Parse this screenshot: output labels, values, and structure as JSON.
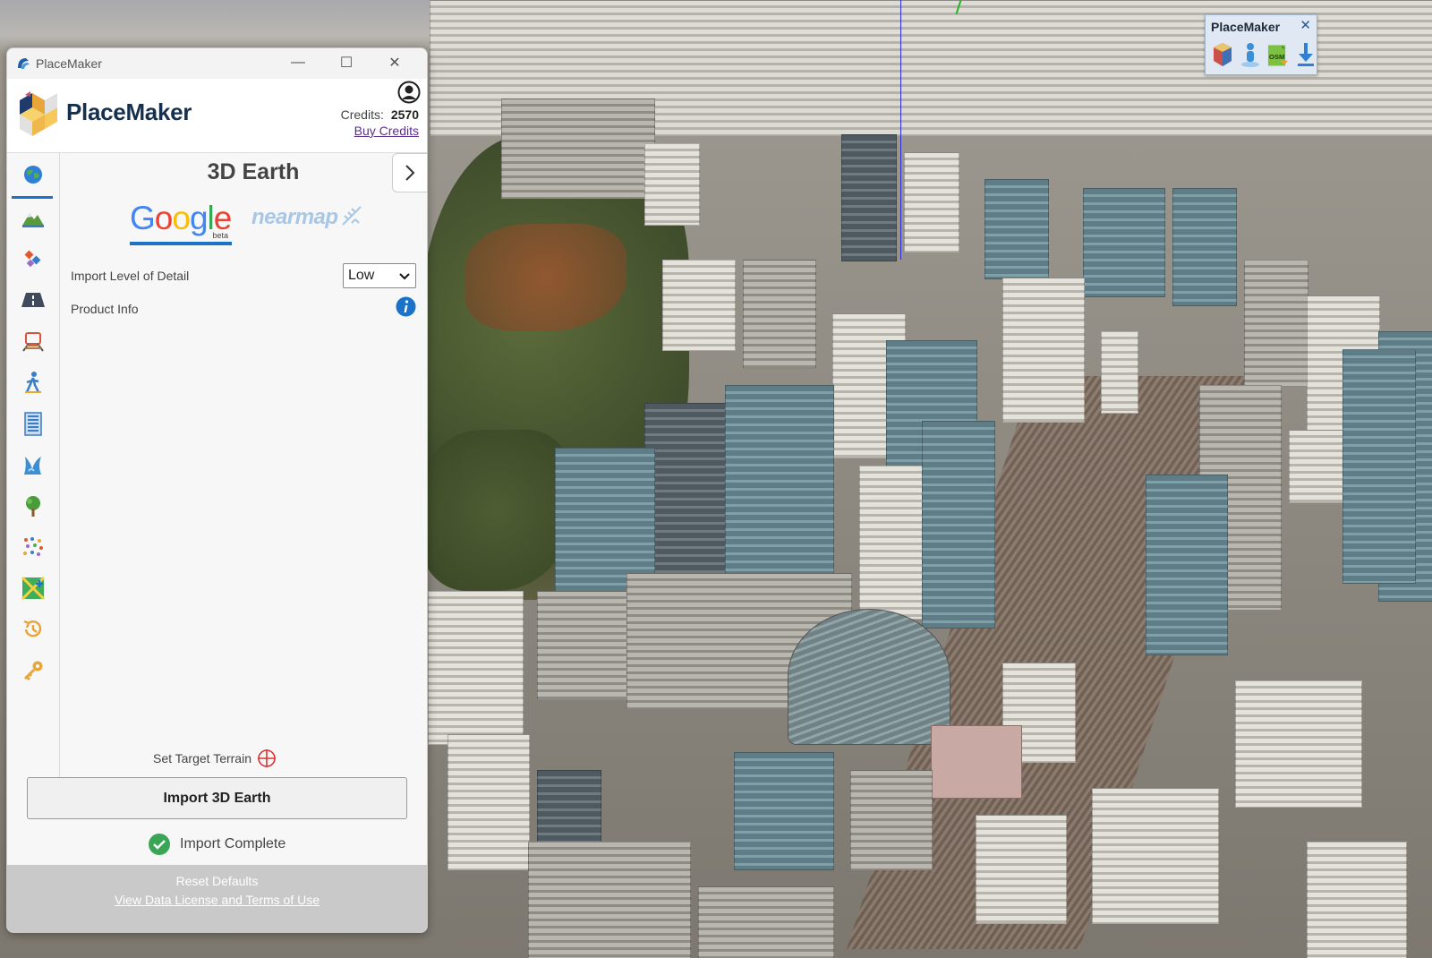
{
  "toolbar": {
    "title": "PlaceMaker",
    "close_glyph": "✕",
    "icons": [
      "cube-icon",
      "person-icon",
      "osm-icon",
      "download-icon"
    ],
    "osm_text": "OSM"
  },
  "window": {
    "title": "PlaceMaker",
    "minimize_glyph": "—",
    "maximize_glyph": "☐",
    "close_glyph": "✕"
  },
  "header": {
    "brand": "PlaceMaker",
    "credits_label": "Credits:",
    "credits_value": "2570",
    "buy_credits": "Buy Credits"
  },
  "sidebar": {
    "items": [
      {
        "name": "3d-earth-globe-icon"
      },
      {
        "name": "terrain-icon"
      },
      {
        "name": "satellite-imagery-icon"
      },
      {
        "name": "roads-icon"
      },
      {
        "name": "railway-icon"
      },
      {
        "name": "pedestrian-icon"
      },
      {
        "name": "buildings-icon"
      },
      {
        "name": "water-icon"
      },
      {
        "name": "trees-icon"
      },
      {
        "name": "scatter-icon"
      },
      {
        "name": "custom-map-icon"
      },
      {
        "name": "history-icon"
      },
      {
        "name": "license-key-icon"
      }
    ],
    "active_index": 0
  },
  "panel": {
    "title": "3D Earth",
    "providers": {
      "google": "Google",
      "google_badge": "beta",
      "nearmap": "nearmap"
    },
    "lod_label": "Import Level of Detail",
    "lod_value": "Low",
    "product_info_label": "Product Info",
    "set_target_terrain": "Set Target Terrain",
    "import_button": "Import 3D Earth",
    "status": "Import Complete"
  },
  "footer": {
    "reset": "Reset Defaults",
    "license": "View Data License and Terms of Use"
  },
  "colors": {
    "accent": "#1a73c9",
    "brand_text": "#15304f",
    "success": "#3aa655",
    "footer_bg": "#c9c9c9"
  }
}
